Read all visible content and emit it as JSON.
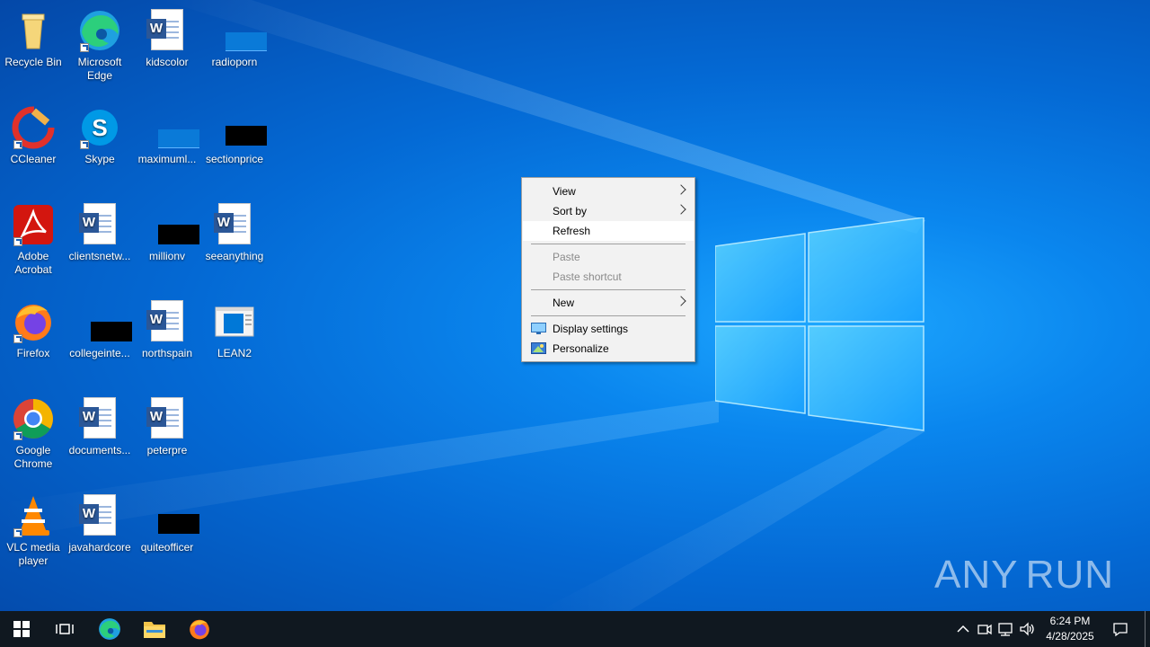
{
  "desktop_icons": [
    {
      "label": "Recycle Bin",
      "icon": "recycle-bin-icon"
    },
    {
      "label": "Microsoft Edge",
      "icon": "edge-icon"
    },
    {
      "label": "kidscolor",
      "icon": "word-document-icon"
    },
    {
      "label": "radioporn",
      "icon": "blank-file-icon"
    },
    {
      "label": "CCleaner",
      "icon": "ccleaner-icon"
    },
    {
      "label": "Skype",
      "icon": "skype-icon"
    },
    {
      "label": "maximuml...",
      "icon": "blank-file-icon"
    },
    {
      "label": "sectionprice",
      "icon": "black-file-icon"
    },
    {
      "label": "Adobe Acrobat",
      "icon": "acrobat-icon"
    },
    {
      "label": "clientsnetw...",
      "icon": "word-document-icon"
    },
    {
      "label": "millionv",
      "icon": "black-file-icon"
    },
    {
      "label": "seeanything",
      "icon": "word-document-icon"
    },
    {
      "label": "Firefox",
      "icon": "firefox-icon"
    },
    {
      "label": "collegeinte...",
      "icon": "black-file-icon"
    },
    {
      "label": "northspain",
      "icon": "word-document-icon"
    },
    {
      "label": "LEAN2",
      "icon": "window-file-icon"
    },
    {
      "label": "Google Chrome",
      "icon": "chrome-icon"
    },
    {
      "label": "documents...",
      "icon": "word-document-icon"
    },
    {
      "label": "peterpre",
      "icon": "word-document-icon"
    },
    {
      "label": "VLC media player",
      "icon": "vlc-icon"
    },
    {
      "label": "javahardcore",
      "icon": "word-document-icon"
    },
    {
      "label": "quiteofficer",
      "icon": "black-file-icon"
    }
  ],
  "context_menu": {
    "view": "View",
    "sort_by": "Sort by",
    "refresh": "Refresh",
    "paste": "Paste",
    "paste_shortcut": "Paste shortcut",
    "new": "New",
    "display_settings": "Display settings",
    "personalize": "Personalize"
  },
  "watermark": {
    "left": "ANY",
    "right": "RUN"
  },
  "taskbar": {
    "pinned": [
      "start-icon",
      "task-view-icon",
      "edge-icon",
      "file-explorer-icon",
      "firefox-icon"
    ],
    "clock": {
      "time": "6:24 PM",
      "date": "4/28/2025"
    }
  },
  "colors": {
    "desktop_blue": "#0a86ee",
    "taskbar": "#101820",
    "menu_bg": "#f2f2f2"
  }
}
